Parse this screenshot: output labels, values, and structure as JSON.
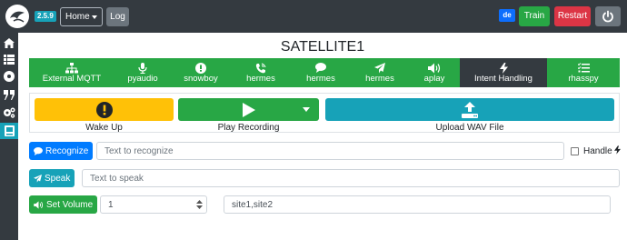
{
  "navbar": {
    "version": "2.5.9",
    "profile_select": "Home",
    "log_label": "Log",
    "language": "de",
    "train_label": "Train",
    "restart_label": "Restart",
    "power_icon": "power-icon"
  },
  "sidebar": {
    "items": [
      {
        "icon": "home-icon"
      },
      {
        "icon": "list-icon"
      },
      {
        "icon": "disc-icon"
      },
      {
        "icon": "quote-icon"
      },
      {
        "icon": "cogs-icon"
      },
      {
        "icon": "book-icon",
        "active": true
      }
    ]
  },
  "page": {
    "title": "SATELLITE1"
  },
  "tabs": [
    {
      "label": "External MQTT",
      "icon": "network-icon"
    },
    {
      "label": "pyaudio",
      "icon": "microphone-icon"
    },
    {
      "label": "snowboy",
      "icon": "exclamation-icon"
    },
    {
      "label": "hermes",
      "icon": "phone-volume-icon"
    },
    {
      "label": "hermes",
      "icon": "comment-icon"
    },
    {
      "label": "hermes",
      "icon": "paper-plane-icon"
    },
    {
      "label": "aplay",
      "icon": "volume-icon"
    },
    {
      "label": "Intent Handling",
      "icon": "bolt-icon",
      "active": true
    },
    {
      "label": "rhasspy",
      "icon": "tasks-icon"
    }
  ],
  "actions": {
    "wake_up_label": "Wake Up",
    "play_recording_label": "Play Recording",
    "upload_wav_label": "Upload WAV File"
  },
  "recognize": {
    "button_label": "Recognize",
    "placeholder": "Text to recognize",
    "handle_label": "Handle"
  },
  "speak": {
    "button_label": "Speak",
    "placeholder": "Text to speak"
  },
  "volume": {
    "button_label": "Set Volume",
    "value": "1",
    "site_ids": "site1,site2"
  },
  "colors": {
    "navbar": "#343a40",
    "success": "#28a745",
    "danger": "#dc3545",
    "info": "#17a2b8",
    "warning": "#ffc107",
    "primary": "#007bff",
    "secondary": "#6c757d"
  }
}
